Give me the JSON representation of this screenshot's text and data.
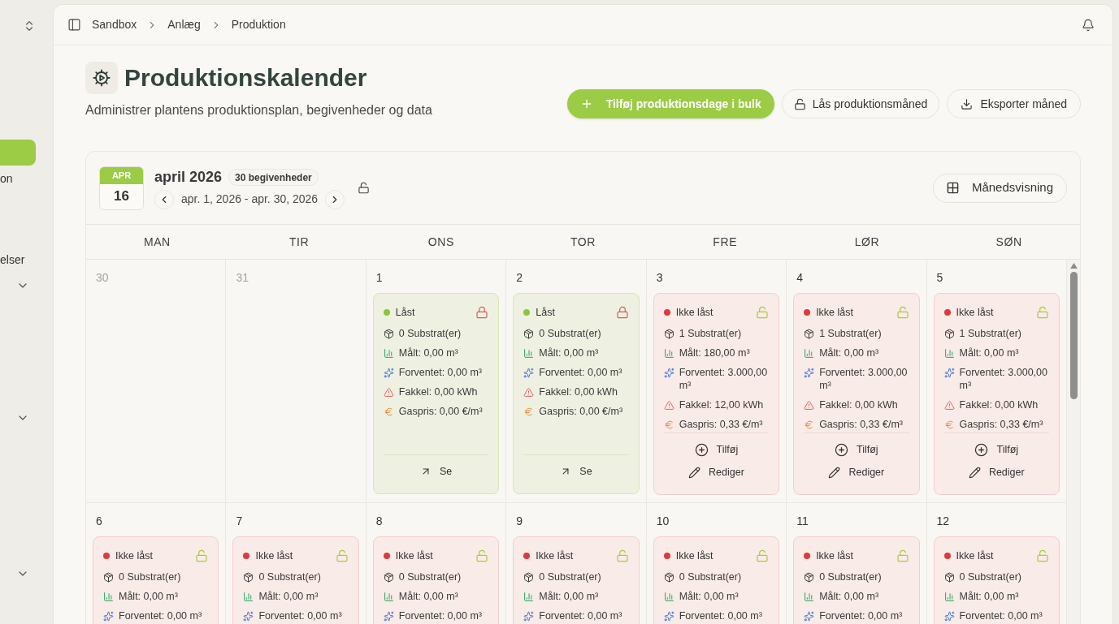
{
  "sidebar": {
    "entries": [
      {
        "kind": "switcher"
      },
      {
        "kind": "item",
        "selected": true
      },
      {
        "kind": "item",
        "label": "on",
        "selected": false
      },
      {
        "kind": "item",
        "label": "elser",
        "selected": false
      },
      {
        "kind": "group"
      },
      {
        "kind": "group"
      },
      {
        "kind": "group"
      }
    ]
  },
  "header": {
    "breadcrumbs": [
      "Sandbox",
      "Anlæg",
      "Produktion"
    ]
  },
  "page": {
    "title": "Produktionskalender",
    "subtitle": "Administrer plantens produktionsplan, begivenheder og data",
    "actions": [
      {
        "kind": "primary",
        "label": "Tilføj produktionsdage i bulk"
      },
      {
        "kind": "lock",
        "label": "Lås produktionsmåned"
      },
      {
        "kind": "export",
        "label": "Eksporter måned"
      }
    ]
  },
  "calendar": {
    "badge_month": "APR",
    "badge_day": "16",
    "month_title": "april 2026",
    "event_count": "30 begivenheder",
    "range": "apr. 1, 2026 - apr. 30, 2026",
    "month_locked": false,
    "view_button": "Månedsvisning",
    "weekdays": [
      "MAN",
      "TIR",
      "ONS",
      "TOR",
      "FRE",
      "LØR",
      "SØN"
    ],
    "weeks": [
      {
        "days": [
          {
            "day": "30",
            "outside": true
          },
          {
            "day": "31",
            "outside": true
          },
          {
            "day": "1",
            "outside": false,
            "entry": {
              "locked": true,
              "status": "Låst",
              "lines": [
                {
                  "kind": "substrates",
                  "text": "0 Substrat(er)"
                },
                {
                  "kind": "measured",
                  "text": "Målt: 0,00 m³"
                },
                {
                  "kind": "expected",
                  "text": "Forventet: 0,00 m³"
                },
                {
                  "kind": "flare",
                  "text": "Fakkel: 0,00 kWh"
                },
                {
                  "kind": "gas_price",
                  "text": "Gaspris: 0,00 €/m³"
                }
              ],
              "actions": [
                {
                  "kind": "view",
                  "label": "Se"
                }
              ]
            }
          },
          {
            "day": "2",
            "outside": false,
            "entry": {
              "locked": true,
              "status": "Låst",
              "lines": [
                {
                  "kind": "substrates",
                  "text": "0 Substrat(er)"
                },
                {
                  "kind": "measured",
                  "text": "Målt: 0,00 m³"
                },
                {
                  "kind": "expected",
                  "text": "Forventet: 0,00 m³"
                },
                {
                  "kind": "flare",
                  "text": "Fakkel: 0,00 kWh"
                },
                {
                  "kind": "gas_price",
                  "text": "Gaspris: 0,00 €/m³"
                }
              ],
              "actions": [
                {
                  "kind": "view",
                  "label": "Se"
                }
              ]
            }
          },
          {
            "day": "3",
            "outside": false,
            "entry": {
              "locked": false,
              "status": "Ikke låst",
              "lines": [
                {
                  "kind": "substrates",
                  "text": "1 Substrat(er)"
                },
                {
                  "kind": "measured",
                  "text": "Målt: 180,00 m³"
                },
                {
                  "kind": "expected",
                  "text": "Forventet: 3.000,00 m³"
                },
                {
                  "kind": "flare",
                  "text": "Fakkel: 12,00 kWh"
                },
                {
                  "kind": "gas_price",
                  "text": "Gaspris: 0,33 €/m³"
                }
              ],
              "actions": [
                {
                  "kind": "add",
                  "label": "Tilføj"
                },
                {
                  "kind": "edit",
                  "label": "Rediger"
                }
              ]
            }
          },
          {
            "day": "4",
            "outside": false,
            "entry": {
              "locked": false,
              "status": "Ikke låst",
              "lines": [
                {
                  "kind": "substrates",
                  "text": "1 Substrat(er)"
                },
                {
                  "kind": "measured",
                  "text": "Målt: 0,00 m³"
                },
                {
                  "kind": "expected",
                  "text": "Forventet: 3.000,00 m³"
                },
                {
                  "kind": "flare",
                  "text": "Fakkel: 0,00 kWh"
                },
                {
                  "kind": "gas_price",
                  "text": "Gaspris: 0,33 €/m³"
                }
              ],
              "actions": [
                {
                  "kind": "add",
                  "label": "Tilføj"
                },
                {
                  "kind": "edit",
                  "label": "Rediger"
                }
              ]
            }
          },
          {
            "day": "5",
            "outside": false,
            "entry": {
              "locked": false,
              "status": "Ikke låst",
              "lines": [
                {
                  "kind": "substrates",
                  "text": "1 Substrat(er)"
                },
                {
                  "kind": "measured",
                  "text": "Målt: 0,00 m³"
                },
                {
                  "kind": "expected",
                  "text": "Forventet: 3.000,00 m³"
                },
                {
                  "kind": "flare",
                  "text": "Fakkel: 0,00 kWh"
                },
                {
                  "kind": "gas_price",
                  "text": "Gaspris: 0,33 €/m³"
                }
              ],
              "actions": [
                {
                  "kind": "add",
                  "label": "Tilføj"
                },
                {
                  "kind": "edit",
                  "label": "Rediger"
                }
              ]
            }
          }
        ]
      },
      {
        "days": [
          {
            "day": "6",
            "outside": false,
            "entry": {
              "locked": false,
              "status": "Ikke låst",
              "lines": [
                {
                  "kind": "substrates",
                  "text": "0 Substrat(er)"
                },
                {
                  "kind": "measured",
                  "text": "Målt: 0,00 m³"
                },
                {
                  "kind": "expected",
                  "text": "Forventet: 0,00 m³"
                }
              ]
            }
          },
          {
            "day": "7",
            "outside": false,
            "entry": {
              "locked": false,
              "status": "Ikke låst",
              "lines": [
                {
                  "kind": "substrates",
                  "text": "0 Substrat(er)"
                },
                {
                  "kind": "measured",
                  "text": "Målt: 0,00 m³"
                },
                {
                  "kind": "expected",
                  "text": "Forventet: 0,00 m³"
                }
              ]
            }
          },
          {
            "day": "8",
            "outside": false,
            "entry": {
              "locked": false,
              "status": "Ikke låst",
              "lines": [
                {
                  "kind": "substrates",
                  "text": "0 Substrat(er)"
                },
                {
                  "kind": "measured",
                  "text": "Målt: 0,00 m³"
                },
                {
                  "kind": "expected",
                  "text": "Forventet: 0,00 m³"
                }
              ]
            }
          },
          {
            "day": "9",
            "outside": false,
            "entry": {
              "locked": false,
              "status": "Ikke låst",
              "lines": [
                {
                  "kind": "substrates",
                  "text": "0 Substrat(er)"
                },
                {
                  "kind": "measured",
                  "text": "Målt: 0,00 m³"
                },
                {
                  "kind": "expected",
                  "text": "Forventet: 0,00 m³"
                }
              ]
            }
          },
          {
            "day": "10",
            "outside": false,
            "entry": {
              "locked": false,
              "status": "Ikke låst",
              "lines": [
                {
                  "kind": "substrates",
                  "text": "0 Substrat(er)"
                },
                {
                  "kind": "measured",
                  "text": "Målt: 0,00 m³"
                },
                {
                  "kind": "expected",
                  "text": "Forventet: 0,00 m³"
                }
              ]
            }
          },
          {
            "day": "11",
            "outside": false,
            "entry": {
              "locked": false,
              "status": "Ikke låst",
              "lines": [
                {
                  "kind": "substrates",
                  "text": "0 Substrat(er)"
                },
                {
                  "kind": "measured",
                  "text": "Målt: 0,00 m³"
                },
                {
                  "kind": "expected",
                  "text": "Forventet: 0,00 m³"
                }
              ]
            }
          },
          {
            "day": "12",
            "outside": false,
            "entry": {
              "locked": false,
              "status": "Ikke låst",
              "lines": [
                {
                  "kind": "substrates",
                  "text": "0 Substrat(er)"
                },
                {
                  "kind": "measured",
                  "text": "Målt: 0,00 m³"
                },
                {
                  "kind": "expected",
                  "text": "Forventet: 0,00 m³"
                }
              ]
            }
          }
        ]
      }
    ]
  }
}
